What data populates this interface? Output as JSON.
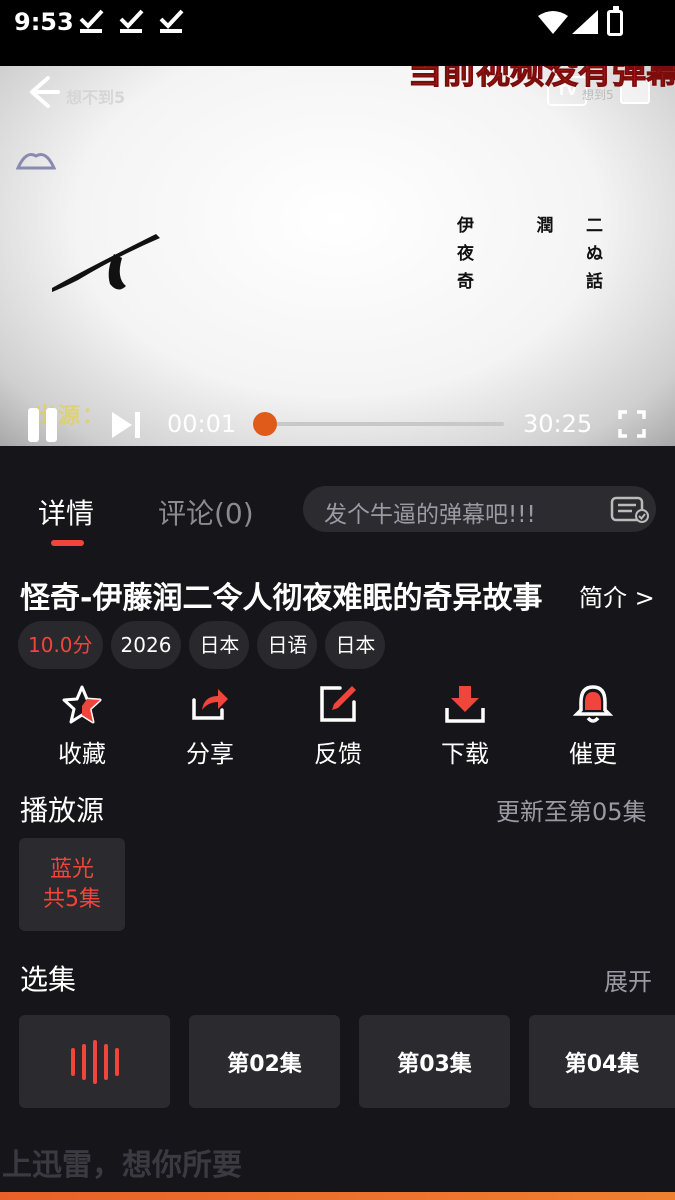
{
  "status_bar": {
    "time": "9:53",
    "icons": [
      "download-check-icon",
      "download-check-icon",
      "download-check-icon",
      "wifi-icon",
      "signal-icon",
      "battery-icon"
    ]
  },
  "player": {
    "danmu_notice": "当前视频没有弹幕",
    "watermark_text": "想不到5",
    "watermark_right": "想到5",
    "tv_label": "TV",
    "credits": [
      [
        "伊",
        "潤",
        "二"
      ],
      [
        "夜",
        "",
        "ぬ"
      ],
      [
        "奇",
        "",
        "話"
      ]
    ],
    "subtitle_watermark": "出源：",
    "current_time": "00:01",
    "total_time": "30:25",
    "progress": 0.0
  },
  "tabs": {
    "detail": "详情",
    "comments": "评论(0)",
    "danmu_placeholder": "发个牛逼的弹幕吧!!!"
  },
  "show": {
    "title": "怪奇-伊藤润二令人彻夜难眠的奇异故事",
    "intro_link": "简介 >",
    "tags": [
      "10.0分",
      "2026",
      "日本",
      "日语",
      "日本"
    ]
  },
  "actions": [
    "收藏",
    "分享",
    "反馈",
    "下载",
    "催更"
  ],
  "sources": {
    "title": "播放源",
    "update": "更新至第05集",
    "card_line1": "蓝光",
    "card_line2": "共5集"
  },
  "episodes": {
    "title": "选集",
    "expand": "展开",
    "items": [
      "第02集",
      "第03集",
      "第04集"
    ]
  },
  "bottom_text": "上迅雷，想你所要",
  "colors": {
    "accent": "#f0453a",
    "progress_thumb": "#e05a1a",
    "background": "#16161a",
    "card": "#2a2a2f"
  }
}
